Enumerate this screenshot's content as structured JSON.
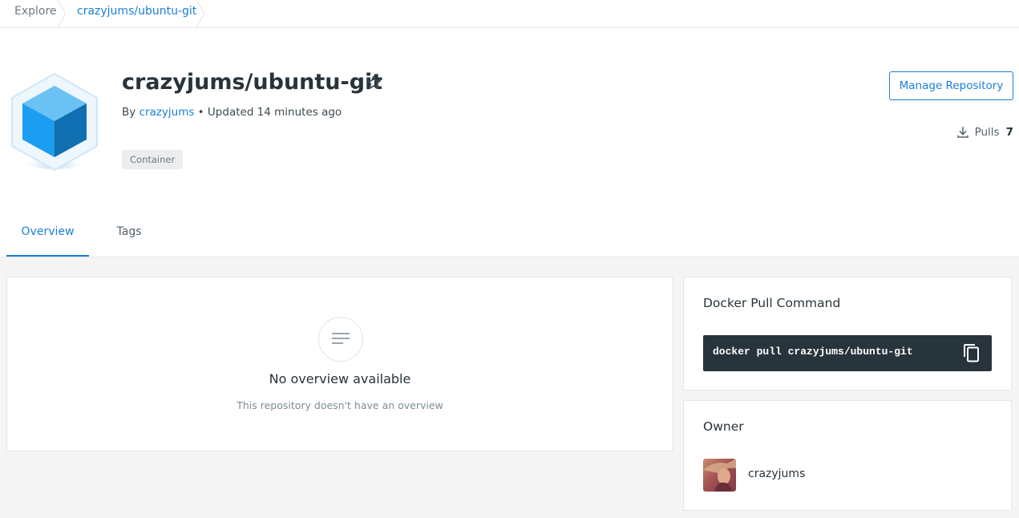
{
  "breadcrumb": {
    "items": [
      "Explore",
      "crazyjums/ubuntu-git"
    ]
  },
  "repo": {
    "title": "crazyjums/ubuntu-git",
    "by_prefix": "By",
    "owner": "crazyjums",
    "updated": "• Updated 14 minutes ago",
    "badge": "Container"
  },
  "actions": {
    "manage_label": "Manage Repository"
  },
  "stats": {
    "pulls_label": "Pulls",
    "pulls_count": "7"
  },
  "tabs": [
    {
      "label": "Overview",
      "active": true
    },
    {
      "label": "Tags",
      "active": false
    }
  ],
  "overview": {
    "empty_title": "No overview available",
    "empty_subtitle": "This repository doesn't have an overview"
  },
  "pull_command": {
    "title": "Docker Pull Command",
    "command": "docker pull crazyjums/ubuntu-git"
  },
  "owner": {
    "title": "Owner",
    "name": "crazyjums"
  },
  "colors": {
    "accent": "#1a7fd8",
    "command_bg": "#27343b",
    "page_bg": "#f5f5f5"
  },
  "icons": [
    "star-icon",
    "download-icon",
    "copy-icon",
    "lines-icon",
    "cube-logo"
  ]
}
